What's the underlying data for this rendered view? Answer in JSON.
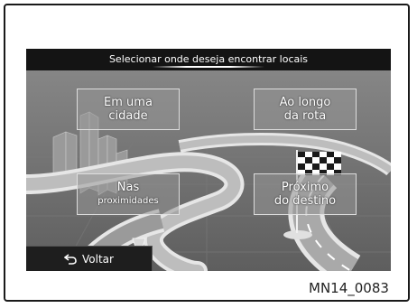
{
  "screen": {
    "title": "Selecionar onde deseja encontrar locais",
    "options": [
      {
        "line1": "Em uma",
        "line2": "cidade"
      },
      {
        "line1": "Ao longo",
        "line2": "da rota"
      },
      {
        "line1": "Nas",
        "line2": "proximidades"
      },
      {
        "line1": "Próximo",
        "line2": "do destino"
      }
    ],
    "back_label": "Voltar",
    "back_icon": "return-arrow-icon"
  },
  "figure_code": "MN14_0083"
}
